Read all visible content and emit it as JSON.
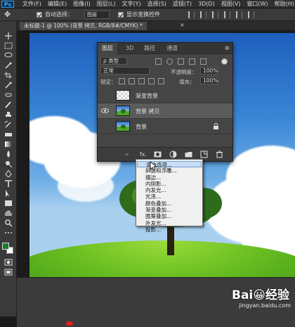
{
  "menubar": {
    "logo": "Ps",
    "items": [
      "文件(F)",
      "编辑(E)",
      "图像(I)",
      "图层(L)",
      "文字(Y)",
      "选择(S)",
      "滤镜(T)",
      "3D(D)",
      "视图(V)",
      "窗口(W)",
      "帮助(H)"
    ]
  },
  "options": {
    "auto_select_label": "自动选择：",
    "auto_select_value": "图层",
    "show_transform_label": "显示变换控件"
  },
  "document": {
    "tab_title": "未标题-1 @ 100% (背景 拷贝, RGB/8#/CMYK) *",
    "close_glyph": "×"
  },
  "layers_panel": {
    "tabs": [
      "图层",
      "3D",
      "路径",
      "通道"
    ],
    "active_tab": "图层",
    "menu_glyph": "≡",
    "filter_kind": "ρ 类型",
    "blend_mode": "正常",
    "opacity_label": "不透明度：",
    "opacity_value": "100%",
    "lock_label": "锁定：",
    "fill_label": "填充：",
    "fill_value": "100%",
    "layers": [
      {
        "name": "渐变背景",
        "visible": false,
        "selected": false,
        "thumb": "checker"
      },
      {
        "name": "背景 拷贝",
        "visible": true,
        "selected": true,
        "thumb": "photo"
      },
      {
        "name": "背景",
        "visible": false,
        "selected": false,
        "thumb": "photo",
        "locked": true
      }
    ],
    "footer_buttons": [
      "link-icon",
      "fx-icon",
      "mask-icon",
      "adjustment-icon",
      "group-icon",
      "new-layer-icon",
      "trash-icon"
    ],
    "footer_fx": "fx."
  },
  "context_menu": {
    "items": [
      "混合选项...",
      "斜面和浮雕...",
      "描边...",
      "内阴影...",
      "内发光...",
      "光泽...",
      "颜色叠加...",
      "渐变叠加...",
      "图案叠加...",
      "外发光...",
      "投影..."
    ],
    "highlighted": "混合选项..."
  },
  "colors": {
    "foreground": "#1a7a2a",
    "background": "#ffffff"
  },
  "watermark": {
    "logo": "Bai😀经验",
    "url": "jingyan.baidu.com"
  }
}
